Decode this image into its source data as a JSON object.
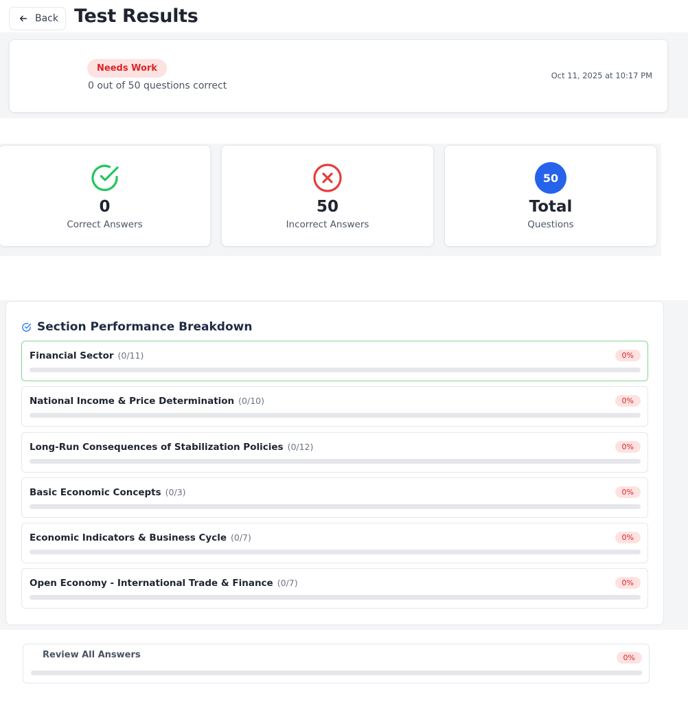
{
  "header": {
    "back_label": "Back",
    "title": "Test Results"
  },
  "summary": {
    "status_badge": "Needs Work",
    "score_text": "0 out of 50 questions correct",
    "date": "Oct 11, 2025 at 10:17 PM"
  },
  "stats": {
    "correct": {
      "value": "0",
      "label": "Correct Answers"
    },
    "incorrect": {
      "value": "50",
      "label": "Incorrect Answers"
    },
    "total": {
      "badge": "50",
      "value": "Total",
      "label": "Questions"
    }
  },
  "sections": {
    "title": "Section Performance Breakdown",
    "items": [
      {
        "name": "Financial Sector",
        "count": "(0/11)",
        "percent": "0%",
        "progress": 0
      },
      {
        "name": "National Income & Price Determination",
        "count": "(0/10)",
        "percent": "0%",
        "progress": 0
      },
      {
        "name": "Long-Run Consequences of Stabilization Policies",
        "count": "(0/12)",
        "percent": "0%",
        "progress": 0
      },
      {
        "name": "Basic Economic Concepts",
        "count": "(0/3)",
        "percent": "0%",
        "progress": 0
      },
      {
        "name": "Economic Indicators & Business Cycle",
        "count": "(0/7)",
        "percent": "0%",
        "progress": 0
      },
      {
        "name": "Open Economy - International Trade & Finance",
        "count": "(0/7)",
        "percent": "0%",
        "progress": 0
      }
    ]
  },
  "review": {
    "label": "Review All Answers",
    "percent": "0%",
    "progress": 0
  },
  "colors": {
    "correct": "#22c55e",
    "incorrect": "#e53e3e",
    "total": "#2563eb",
    "badge_bg": "#fde2e2",
    "badge_text": "#dc2626"
  },
  "icons": {
    "back": "arrow-left-icon",
    "correct": "check-circle-icon",
    "incorrect": "x-circle-icon",
    "section": "check-circle-small-icon"
  }
}
